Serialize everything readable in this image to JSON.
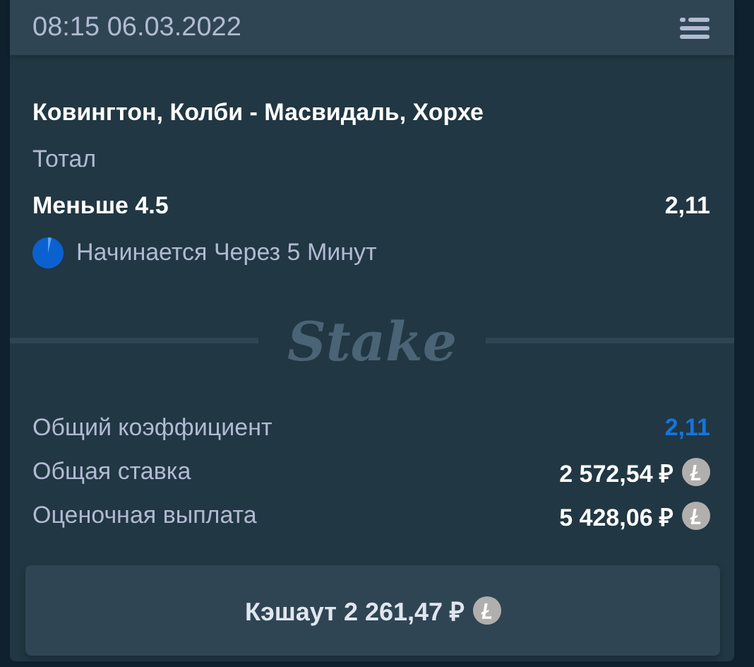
{
  "header": {
    "datetime": "08:15 06.03.2022"
  },
  "bet": {
    "event": "Ковингтон, Колби - Масвидаль, Хорхе",
    "market": "Тотал",
    "outcome": "Меньше 4.5",
    "odds": "2,11",
    "status": "Начинается Через 5 Минут"
  },
  "divider_logo": "Stake",
  "summary": [
    {
      "label": "Общий коэффициент",
      "value": "2,11",
      "kind": "odds"
    },
    {
      "label": "Общая ставка",
      "value": "2 572,54 ₽",
      "kind": "amount"
    },
    {
      "label": "Оценочная выплата",
      "value": "5 428,06 ₽",
      "kind": "amount"
    }
  ],
  "cashout_button": "Кэшаут 2 261,47 ₽"
}
